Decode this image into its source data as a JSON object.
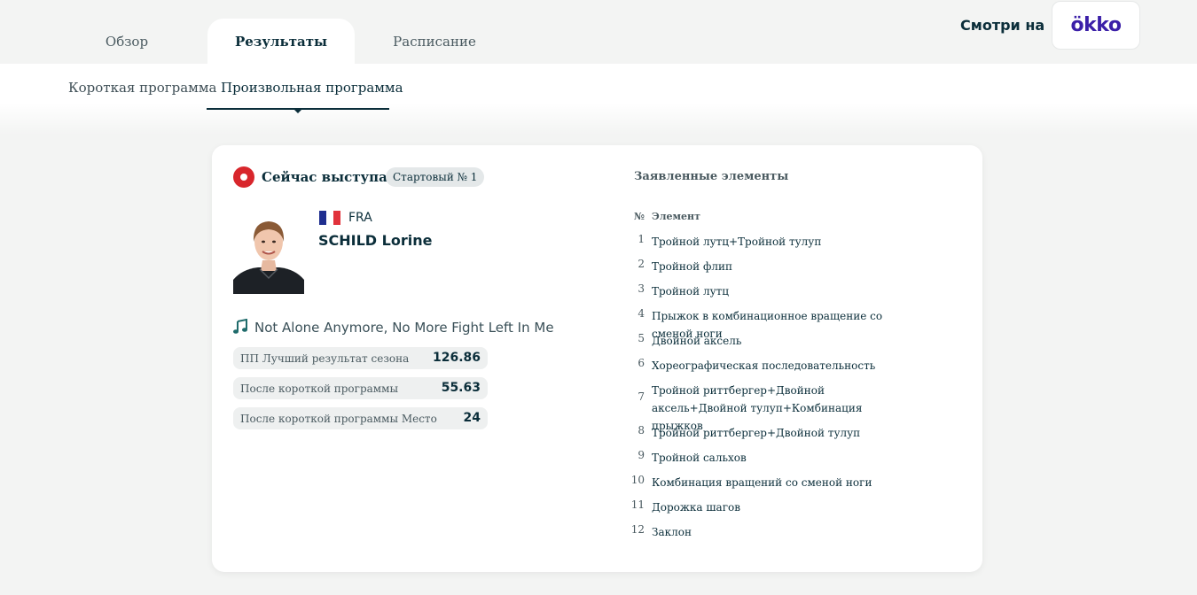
{
  "tabs": [
    {
      "label": "Обзор",
      "active": false
    },
    {
      "label": "Результаты",
      "active": true
    },
    {
      "label": "Расписание",
      "active": false
    }
  ],
  "watch": {
    "label": "Смотри на",
    "brand": "ökko",
    "brand_color": "#3b1fa8"
  },
  "subtabs": [
    {
      "label": "Короткая программа",
      "active": false
    },
    {
      "label": "Произвольная программа",
      "active": true
    }
  ],
  "performer": {
    "live_label": "Сейчас выступает",
    "start_badge": "Стартовый № 1",
    "country": "FRA",
    "name": "SCHILD Lorine",
    "music": "Not Alone Anymore, No More Fight Left In Me",
    "live_color": "#d8262c"
  },
  "stats": [
    {
      "label": "ПП Лучший результат сезона",
      "value": "126.86"
    },
    {
      "label": "После короткой программы",
      "value": "55.63"
    },
    {
      "label": "После короткой программы Место",
      "value": "24"
    }
  ],
  "elements": {
    "title": "Заявленные элементы",
    "col_num": "№",
    "col_name": "Элемент",
    "items": [
      {
        "num": "1",
        "name": "Тройной лутц+Тройной тулуп"
      },
      {
        "num": "2",
        "name": "Тройной флип"
      },
      {
        "num": "3",
        "name": "Тройной лутц"
      },
      {
        "num": "4",
        "name": "Прыжок в комбинационное вращение со сменой ноги"
      },
      {
        "num": "5",
        "name": "Двойной аксель"
      },
      {
        "num": "6",
        "name": "Хореографическая последовательность"
      },
      {
        "num": "7",
        "name": "Тройной риттбергер+Двойной аксель+Двойной тулуп+Комбинация прыжков"
      },
      {
        "num": "8",
        "name": "Тройной риттбергер+Двойной тулуп"
      },
      {
        "num": "9",
        "name": "Тройной сальхов"
      },
      {
        "num": "10",
        "name": "Комбинация вращений со сменой ноги"
      },
      {
        "num": "11",
        "name": "Дорожка шагов"
      },
      {
        "num": "12",
        "name": "Заклон"
      }
    ]
  }
}
